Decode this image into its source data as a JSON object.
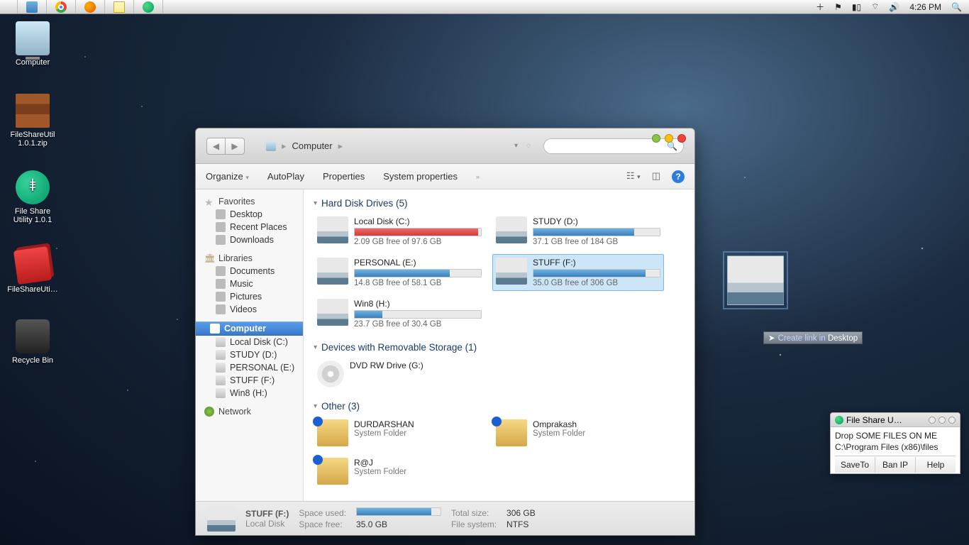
{
  "menubar": {
    "time": "4:26 PM"
  },
  "desktop": {
    "icons": [
      {
        "label": "Computer"
      },
      {
        "label": "FileShareUtil 1.0.1.zip"
      },
      {
        "label": "File Share Utility 1.0.1"
      },
      {
        "label": "FileShareUti…"
      },
      {
        "label": "Recycle Bin"
      }
    ]
  },
  "explorer": {
    "crumb": "Computer",
    "toolbar": {
      "organize": "Organize",
      "autoplay": "AutoPlay",
      "properties": "Properties",
      "sysprops": "System properties"
    },
    "sidebar": {
      "favorites": "Favorites",
      "favs": [
        "Desktop",
        "Recent Places",
        "Downloads"
      ],
      "libraries": "Libraries",
      "libs": [
        "Documents",
        "Music",
        "Pictures",
        "Videos"
      ],
      "computer": "Computer",
      "drives": [
        "Local Disk (C:)",
        "STUDY (D:)",
        "PERSONAL (E:)",
        "STUFF (F:)",
        "Win8 (H:)"
      ],
      "network": "Network"
    },
    "groups": {
      "hdd": "Hard Disk Drives (5)",
      "removable": "Devices with Removable Storage (1)",
      "other": "Other (3)"
    },
    "hdd": [
      {
        "name": "Local Disk (C:)",
        "free": "2.09 GB free of 97.6 GB",
        "pct": 98,
        "red": true
      },
      {
        "name": "STUDY (D:)",
        "free": "37.1 GB free of 184 GB",
        "pct": 80
      },
      {
        "name": "PERSONAL (E:)",
        "free": "14.8 GB free of 58.1 GB",
        "pct": 75
      },
      {
        "name": "STUFF (F:)",
        "free": "35.0 GB free of 306 GB",
        "pct": 89,
        "sel": true
      },
      {
        "name": "Win8 (H:)",
        "free": "23.7 GB free of 30.4 GB",
        "pct": 22
      }
    ],
    "removable": [
      {
        "name": "DVD RW Drive (G:)"
      }
    ],
    "other": [
      {
        "name": "DURDARSHAN",
        "sub": "System Folder"
      },
      {
        "name": "Omprakash",
        "sub": "System Folder"
      },
      {
        "name": "R@J",
        "sub": "System Folder"
      }
    ],
    "status": {
      "name": "STUFF (F:)",
      "type": "Local Disk",
      "space_used_k": "Space used:",
      "space_free_k": "Space free:",
      "space_free_v": "35.0 GB",
      "total_k": "Total size:",
      "total_v": "306 GB",
      "fs_k": "File system:",
      "fs_v": "NTFS",
      "pct": 89
    }
  },
  "util": {
    "title": "File Share U…",
    "line1": "Drop SOME FILES ON ME",
    "line2": "C:\\Program Files (x86)\\files",
    "btn1": "SaveTo",
    "btn2": "Ban IP",
    "btn3": "Help"
  },
  "tooltip": {
    "prefix": "Create link in ",
    "target": "Desktop"
  }
}
